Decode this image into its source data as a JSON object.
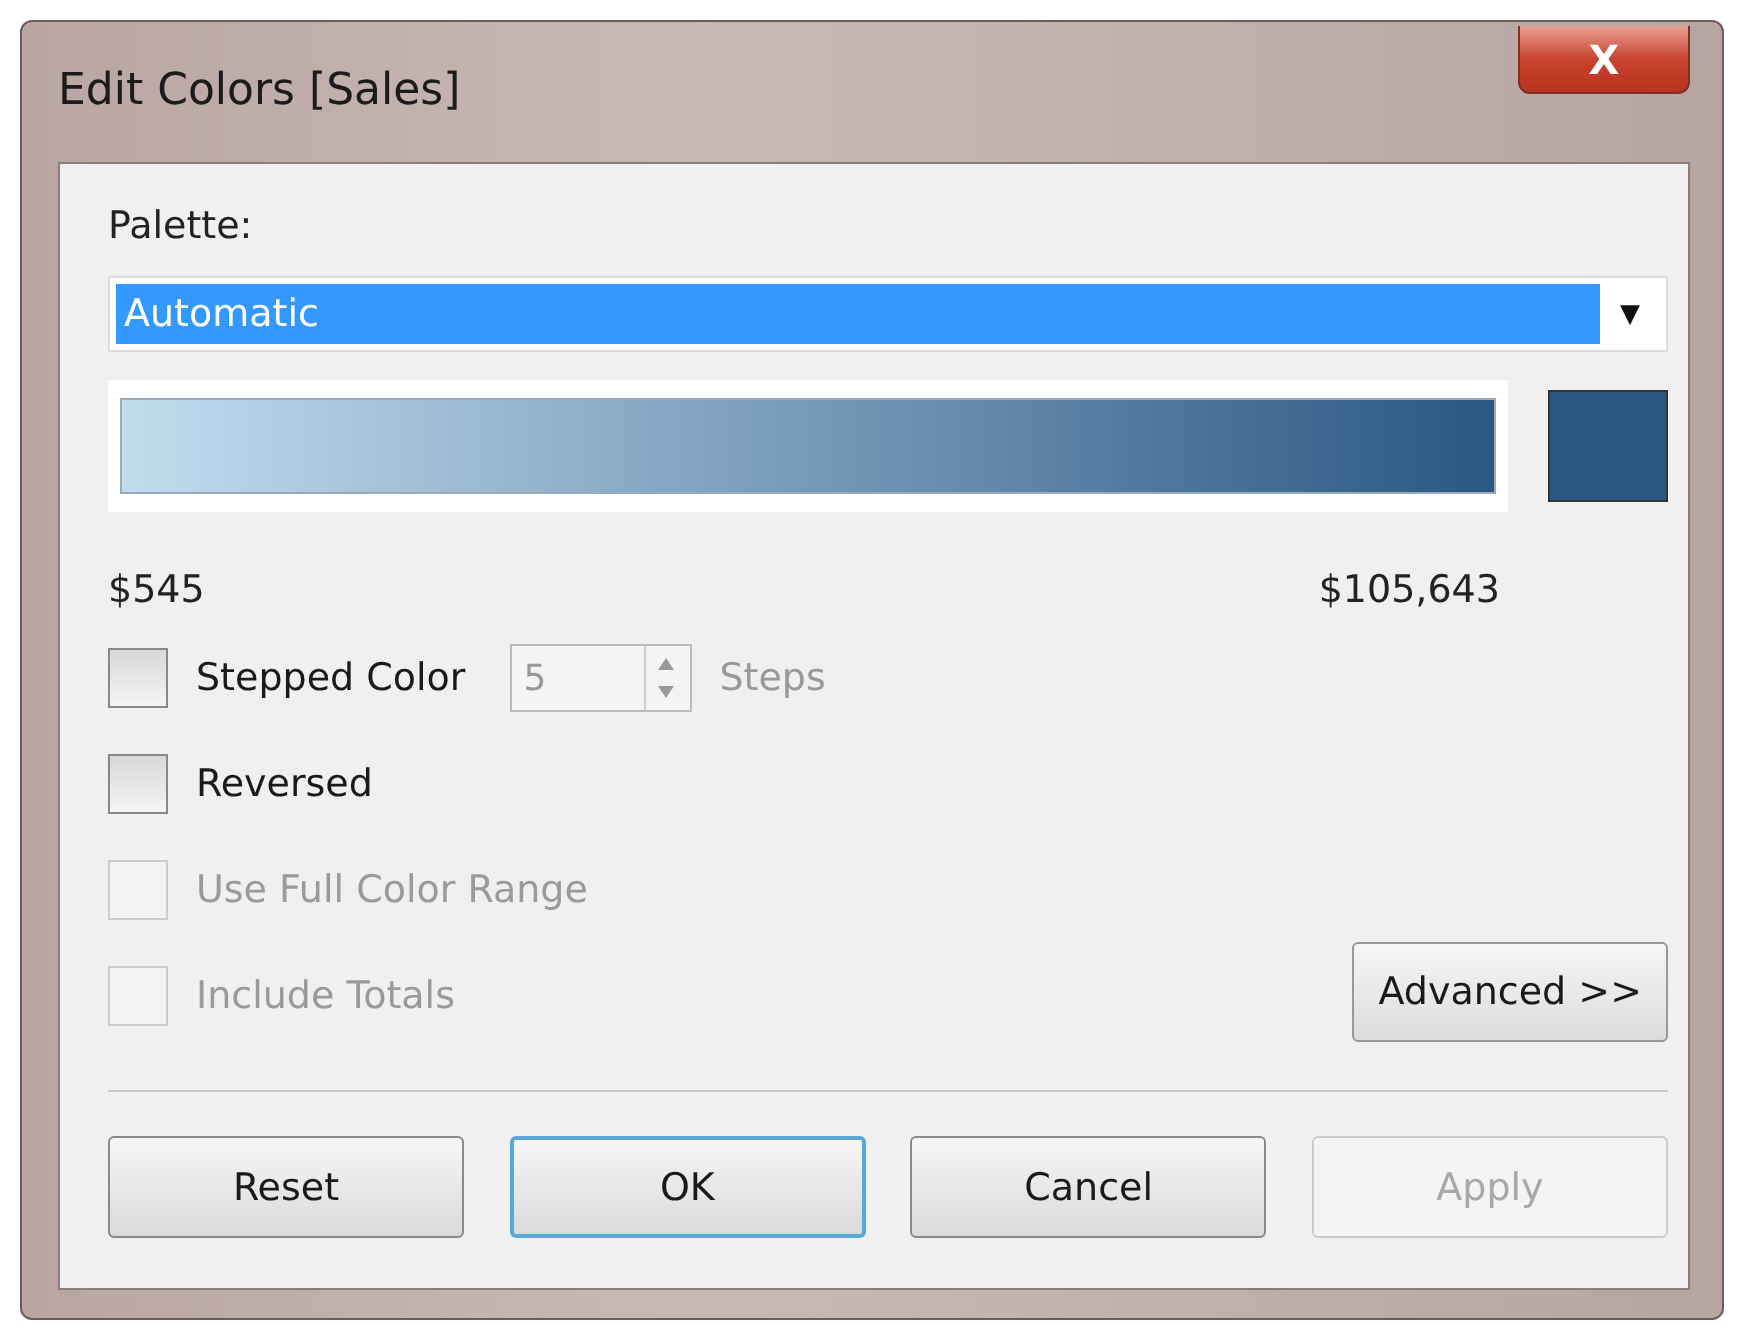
{
  "window": {
    "title": "Edit Colors [Sales]",
    "close_glyph": "X"
  },
  "palette": {
    "label": "Palette:",
    "value": "Automatic",
    "caret": "▼"
  },
  "legend": {
    "stops": [
      {
        "color": "#c2dcee"
      },
      {
        "color": "#2a5783"
      }
    ],
    "swatch": {
      "color": "#2a5783"
    },
    "min": "$545",
    "max": "$105,643"
  },
  "options": [
    {
      "kind": "stepper",
      "label": "Stepped Color",
      "checked": false,
      "disabled": false,
      "steps_value": "5",
      "steps_label": "Steps"
    },
    {
      "kind": "checkbox",
      "label": "Reversed",
      "checked": false,
      "disabled": false
    },
    {
      "kind": "checkbox",
      "label": "Use Full Color Range",
      "checked": false,
      "disabled": true
    },
    {
      "kind": "checkbox",
      "label": "Include Totals",
      "checked": false,
      "disabled": true
    }
  ],
  "advanced_button": "Advanced >>",
  "buttons": [
    {
      "label": "Reset",
      "default": false,
      "disabled": false
    },
    {
      "label": "OK",
      "default": true,
      "disabled": false
    },
    {
      "label": "Cancel",
      "default": false,
      "disabled": false
    },
    {
      "label": "Apply",
      "default": false,
      "disabled": true
    }
  ]
}
